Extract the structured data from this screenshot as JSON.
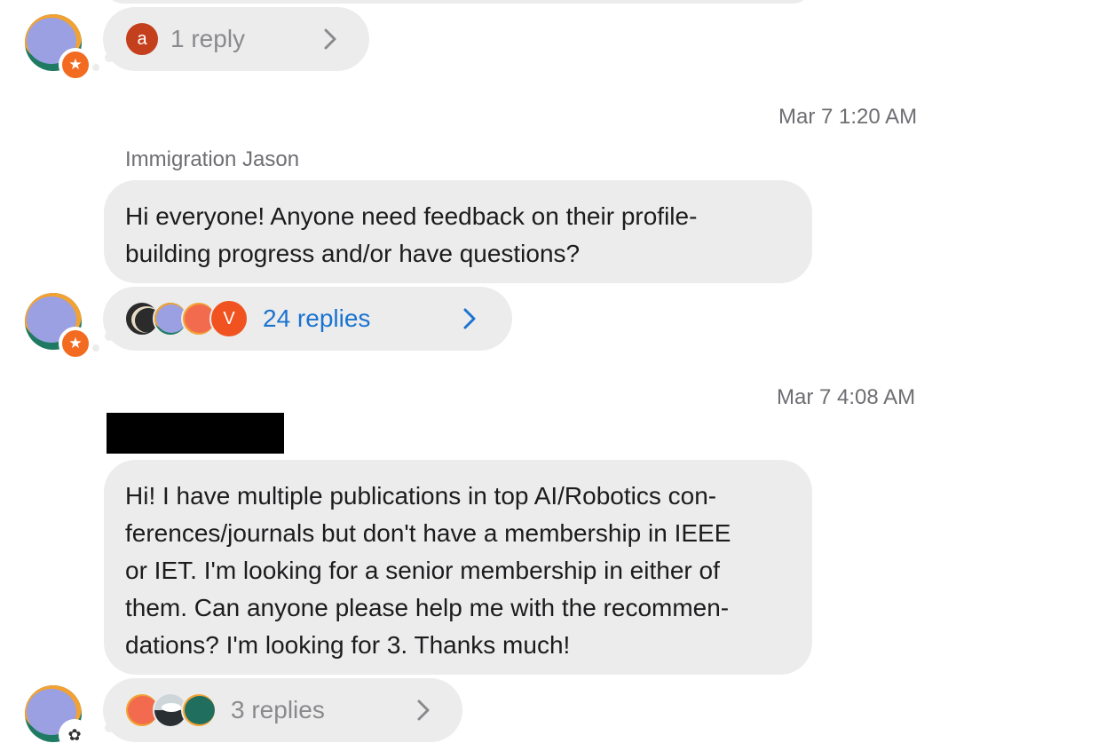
{
  "threads": [
    {
      "reply_pill": {
        "avatars": [
          {
            "letter": "a",
            "color": "#c4401c"
          }
        ],
        "count_label": "1 reply"
      }
    },
    {
      "timestamp": "Mar 7 1:20 AM",
      "sender": "Immigration Jason",
      "message_lines": [
        "Hi everyone! Anyone need feedback on their profile-",
        "building progress and/or have questions?"
      ],
      "reply_pill": {
        "avatars": [
          {
            "color": "#2b2b2b"
          },
          {
            "color": "#9aa0e2"
          },
          {
            "color": "#f26b4e"
          },
          {
            "letter": "V",
            "color": "#f0531f"
          }
        ],
        "count_label": "24 replies"
      }
    },
    {
      "timestamp": "Mar 7 4:08 AM",
      "sender_redacted": true,
      "message_lines": [
        "Hi! I have multiple publications in top AI/Robotics con-",
        "ferences/journals but don't have a membership in IEEE",
        "or IET. I'm looking for a senior membership in either of",
        "them. Can anyone please help me with the recommen-",
        "dations? I'm looking for 3. Thanks much!"
      ],
      "reply_pill": {
        "avatars": [
          {
            "color": "#f26b4e"
          },
          {
            "color": "#cfd6da"
          },
          {
            "color": "#1f6e5e"
          }
        ],
        "count_label": "3 replies"
      }
    }
  ],
  "colors": {
    "bubble": "#ececec",
    "accent_blue": "#1a73d1",
    "badge_orange": "#f26b21",
    "muted_text": "#6e6e73"
  },
  "icons": {
    "badge": "star-icon",
    "badge_alt": "community-icon",
    "chevron": "chevron-right-icon"
  }
}
